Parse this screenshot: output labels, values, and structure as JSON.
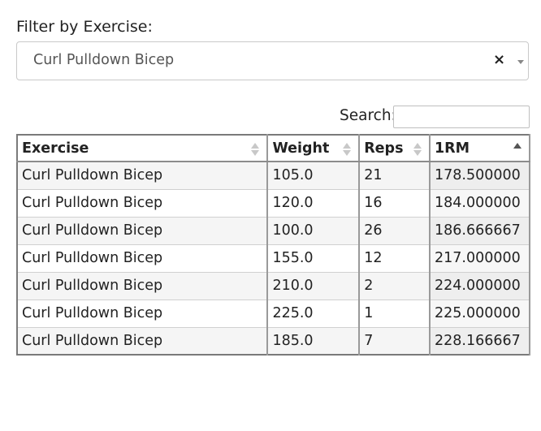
{
  "filter": {
    "label": "Filter by Exercise:",
    "selected": "Curl Pulldown Bicep",
    "clear_glyph": "×"
  },
  "search": {
    "label": "Search:",
    "value": ""
  },
  "table": {
    "columns": [
      {
        "label": "Exercise",
        "sort": "none"
      },
      {
        "label": "Weight",
        "sort": "none"
      },
      {
        "label": "Reps",
        "sort": "none"
      },
      {
        "label": "1RM",
        "sort": "ascending"
      }
    ],
    "rows": [
      [
        "Curl Pulldown Bicep",
        "105.0",
        "21",
        "178.500000"
      ],
      [
        "Curl Pulldown Bicep",
        "120.0",
        "16",
        "184.000000"
      ],
      [
        "Curl Pulldown Bicep",
        "100.0",
        "26",
        "186.666667"
      ],
      [
        "Curl Pulldown Bicep",
        "155.0",
        "12",
        "217.000000"
      ],
      [
        "Curl Pulldown Bicep",
        "210.0",
        "2",
        "224.000000"
      ],
      [
        "Curl Pulldown Bicep",
        "225.0",
        "1",
        "225.000000"
      ],
      [
        "Curl Pulldown Bicep",
        "185.0",
        "7",
        "228.166667"
      ]
    ]
  }
}
